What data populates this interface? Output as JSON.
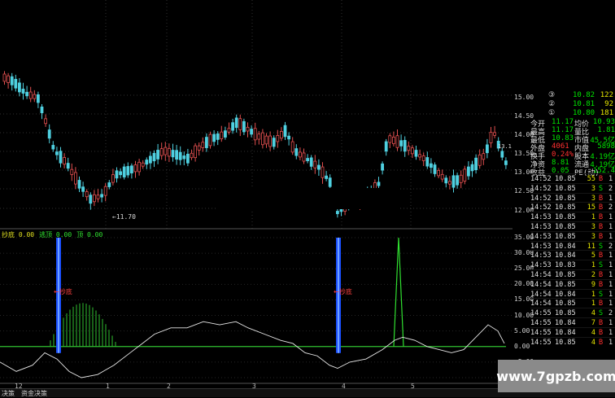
{
  "main_chart": {
    "low_label": "11.70",
    "price_ticks": [
      "15.00",
      "14.50",
      "14.00",
      "13.50",
      "13.00",
      "12.50",
      "12.00"
    ],
    "colors": {
      "up": "#e24f4f",
      "down": "#4fd0e0",
      "grid": "#303030"
    }
  },
  "sub_chart": {
    "legend": [
      {
        "label": "抄底",
        "value": "0.00",
        "color": "#e0e020"
      },
      {
        "label": "逃顶",
        "value": "0.00",
        "color": "#30e030"
      },
      {
        "label": "顶",
        "value": "0.00",
        "color": "#30e030"
      }
    ],
    "signal_text": "抄底",
    "ticks": [
      "35.00",
      "30.00",
      "25.00",
      "20.00",
      "15.00",
      "10.00",
      "5.00",
      "0.00",
      "-5.00",
      "-10.00"
    ],
    "colors": {
      "bar": "#1a4fff",
      "line": "#e8e8e8",
      "hist": "#30c030",
      "zero": "#30c030"
    }
  },
  "date_labels": [
    "12",
    "1",
    "2",
    "3",
    "4",
    "5"
  ],
  "depth": [
    {
      "level": "③",
      "price": "10.82",
      "vol": "122"
    },
    {
      "level": "②",
      "price": "10.81",
      "vol": "92"
    },
    {
      "level": "①",
      "price": "10.80",
      "vol": "181"
    }
  ],
  "quote": [
    {
      "k1": "今开",
      "v1": "11.17",
      "k2": "均价",
      "v2": "10.93"
    },
    {
      "k1": "最高",
      "v1": "11.17",
      "k2": "量比",
      "v2": "1.81"
    },
    {
      "k1": "最低",
      "v1": "10.83",
      "k2": "市值",
      "v2": "45.5亿"
    },
    {
      "k1": "外盘",
      "v1": "4061",
      "k2": "内盘",
      "v2": "5898"
    },
    {
      "k1": "换手",
      "v1": "0.24%",
      "k2": "股本",
      "v2": "4.19亿"
    },
    {
      "k1": "净资",
      "v1": "8.81",
      "k2": "流通",
      "v2": "4.19亿"
    },
    {
      "k1": "收益",
      "v1": "0.05",
      "k2": "PE(动)",
      "v2": "152.4"
    }
  ],
  "ticks": [
    {
      "t": "14:52",
      "p": "10.85",
      "v": "55",
      "s": "B",
      "n": "1"
    },
    {
      "t": "14:52",
      "p": "10.85",
      "v": "3",
      "s": "S",
      "n": "2"
    },
    {
      "t": "14:52",
      "p": "10.85",
      "v": "3",
      "s": "B",
      "n": "1"
    },
    {
      "t": "14:52",
      "p": "10.85",
      "v": "15",
      "s": "B",
      "n": "2"
    },
    {
      "t": "14:53",
      "p": "10.85",
      "v": "1",
      "s": "B",
      "n": "1"
    },
    {
      "t": "14:53",
      "p": "10.85",
      "v": "3",
      "s": "B",
      "n": "1"
    },
    {
      "t": "14:53",
      "p": "10.85",
      "v": "3",
      "s": "B",
      "n": "1"
    },
    {
      "t": "14:53",
      "p": "10.84",
      "v": "11",
      "s": "S",
      "n": "2"
    },
    {
      "t": "14:53",
      "p": "10.84",
      "v": "5",
      "s": "B",
      "n": "1"
    },
    {
      "t": "14:53",
      "p": "10.83",
      "v": "1",
      "s": "S",
      "n": "1"
    },
    {
      "t": "14:54",
      "p": "10.85",
      "v": "2",
      "s": "B",
      "n": "1"
    },
    {
      "t": "14:54",
      "p": "10.85",
      "v": "9",
      "s": "B",
      "n": "1"
    },
    {
      "t": "14:54",
      "p": "10.84",
      "v": "1",
      "s": "S",
      "n": "1"
    },
    {
      "t": "14:54",
      "p": "10.85",
      "v": "1",
      "s": "B",
      "n": "1"
    },
    {
      "t": "14:55",
      "p": "10.85",
      "v": "4",
      "s": "S",
      "n": "2"
    },
    {
      "t": "14:55",
      "p": "10.84",
      "v": "7",
      "s": "B",
      "n": "1"
    },
    {
      "t": "14:55",
      "p": "10.84",
      "v": "4",
      "s": "B",
      "n": "1"
    },
    {
      "t": "14:55",
      "p": "10.85",
      "v": "4",
      "s": "B",
      "n": "1"
    }
  ],
  "bottom_tabs": [
    "决策",
    "资金决策"
  ],
  "watermark": "www.7gpzb.com",
  "right_mini_tick": "13.1"
}
